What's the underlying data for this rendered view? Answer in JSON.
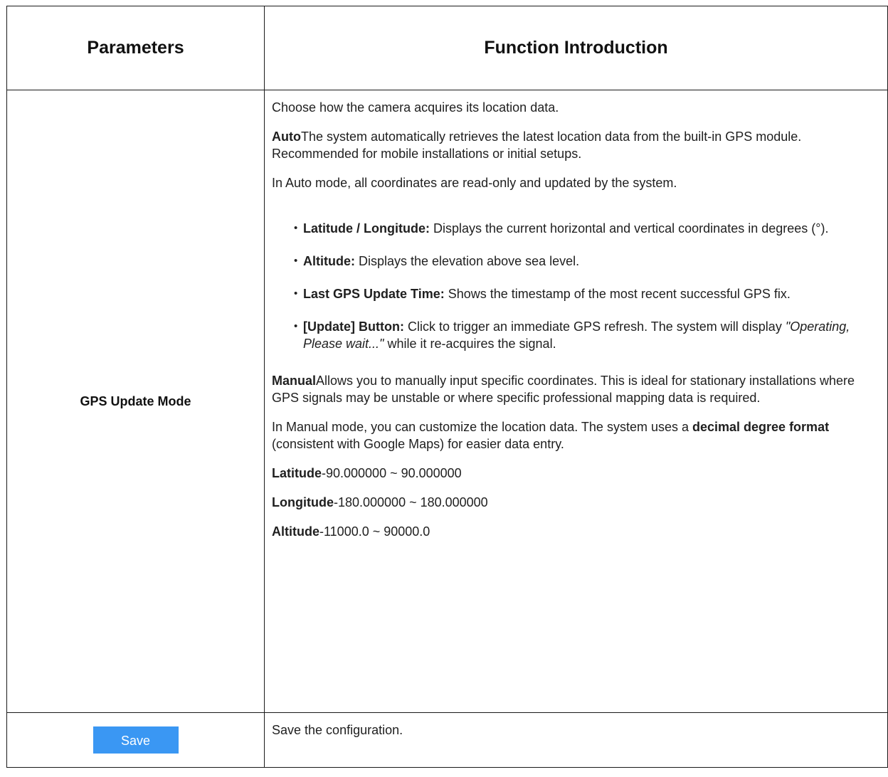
{
  "table": {
    "header": {
      "parameters": "Parameters",
      "function": "Function Introduction"
    },
    "gps_row": {
      "name": "GPS Update Mode",
      "intro": "Choose how the camera acquires its location data.",
      "auto": {
        "label": "Auto",
        "text": "The system automatically retrieves the latest location data from the built-in GPS module. Recommended for mobile installations or initial setups.",
        "note": "In Auto mode, all coordinates are read-only and updated by the system."
      },
      "bullets": [
        {
          "label": "Latitude / Longitude:",
          "text": " Displays the current horizontal and vertical coordinates in degrees (°)."
        },
        {
          "label": "Altitude:",
          "text": " Displays the elevation above sea level."
        },
        {
          "label": "Last GPS Update Time:",
          "text": " Shows the timestamp of the most recent successful GPS fix."
        },
        {
          "label": "[Update] Button:",
          "text": " Click to trigger an immediate GPS refresh. The system will display ",
          "italic": "\"Operating, Please wait...\"",
          "tail": " while it re-acquires the signal."
        }
      ],
      "manual": {
        "label": "Manual",
        "text": "Allows you to manually input specific coordinates. This is ideal for stationary installations where GPS signals may be unstable or where specific professional mapping data is required.",
        "note_pre": "In Manual mode, you can customize the location data. The system uses a ",
        "note_bold": "decimal degree format",
        "note_post": " (consistent with Google Maps) for easier data entry."
      },
      "ranges": [
        {
          "label": "Latitude",
          "value": "-90.000000 ~ 90.000000"
        },
        {
          "label": "Longitude",
          "value": "-180.000000 ~ 180.000000"
        },
        {
          "label": "Altitude",
          "value": "-11000.0 ~ 90000.0"
        }
      ]
    },
    "save_row": {
      "button_label": "Save",
      "description": "Save the configuration."
    }
  },
  "colors": {
    "save_button": "#3a97f3",
    "border": "#1a1a1a"
  }
}
